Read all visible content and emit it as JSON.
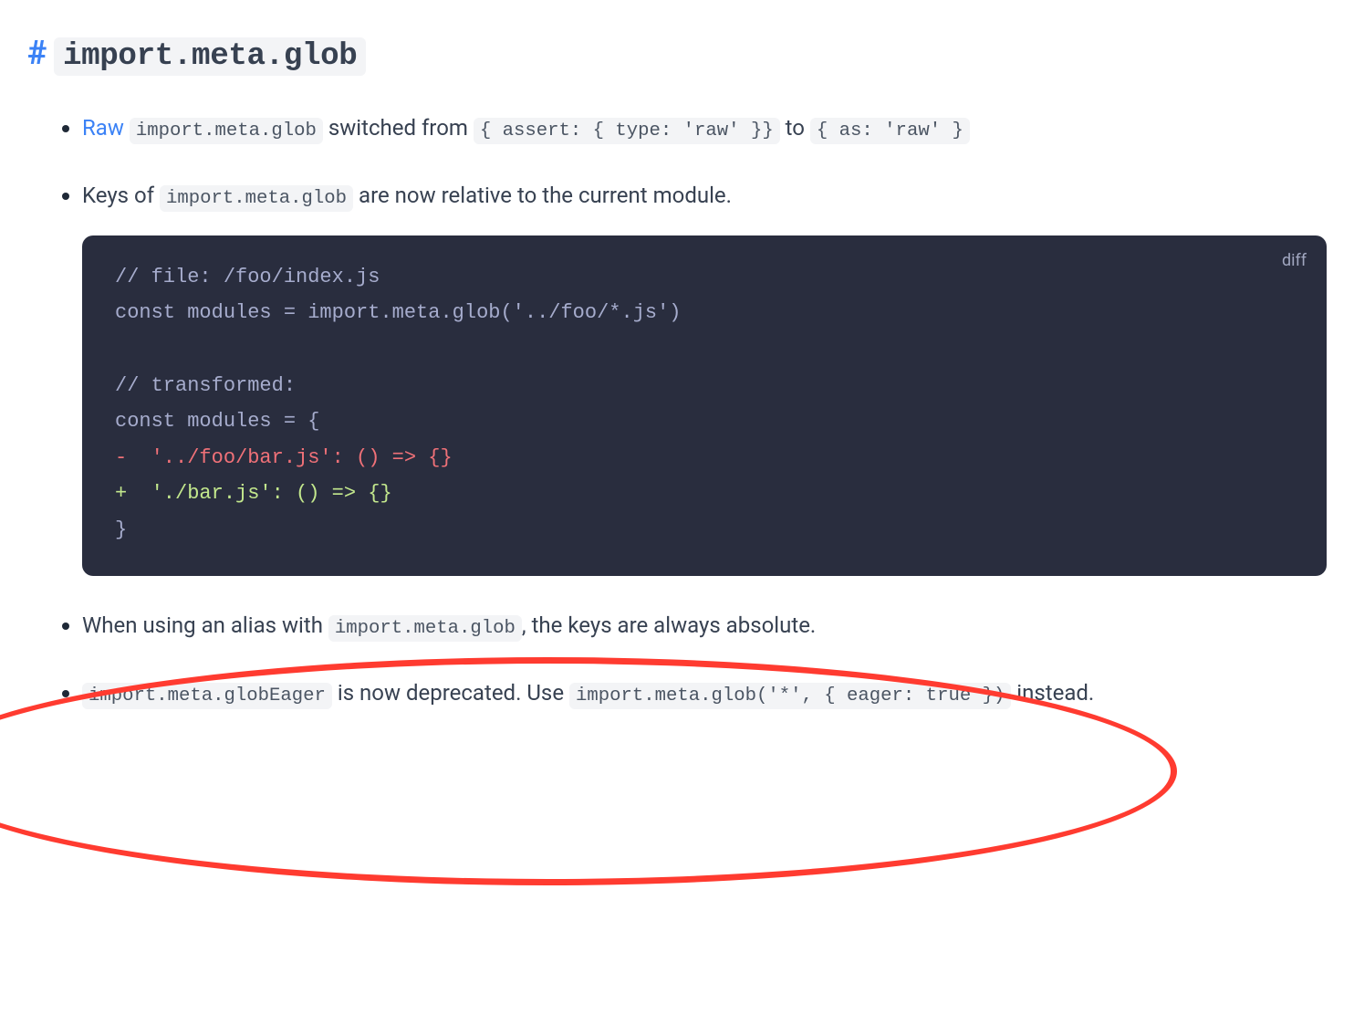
{
  "heading": {
    "hash": "#",
    "code": "import.meta.glob"
  },
  "bullets": {
    "b1": {
      "link": "Raw ",
      "code1": "import.meta.glob",
      "mid1": " switched from ",
      "code2": "{ assert: { type: 'raw' }}",
      "mid2": " to ",
      "code3": "{ as: 'raw' }"
    },
    "b2": {
      "pre": "Keys of ",
      "code": "import.meta.glob",
      "post": " are now relative to the current module."
    },
    "b3": {
      "pre": "When using an alias with ",
      "code": "import.meta.glob",
      "post": ", the keys are always absolute."
    },
    "b4": {
      "code1": "import.meta.globEager",
      "mid1": " is now deprecated. Use ",
      "code2": "import.meta.glob('*', { eager: true })",
      "mid2": " instead."
    }
  },
  "codeblock": {
    "lang": "diff",
    "line1": "// file: /foo/index.js",
    "line2": "const modules = import.meta.glob('../foo/*.js')",
    "blank": "",
    "line3": "// transformed:",
    "line4": "const modules = {",
    "line5": "-  '../foo/bar.js': () => {}",
    "line6": "+  './bar.js': () => {}",
    "line7": "}"
  }
}
